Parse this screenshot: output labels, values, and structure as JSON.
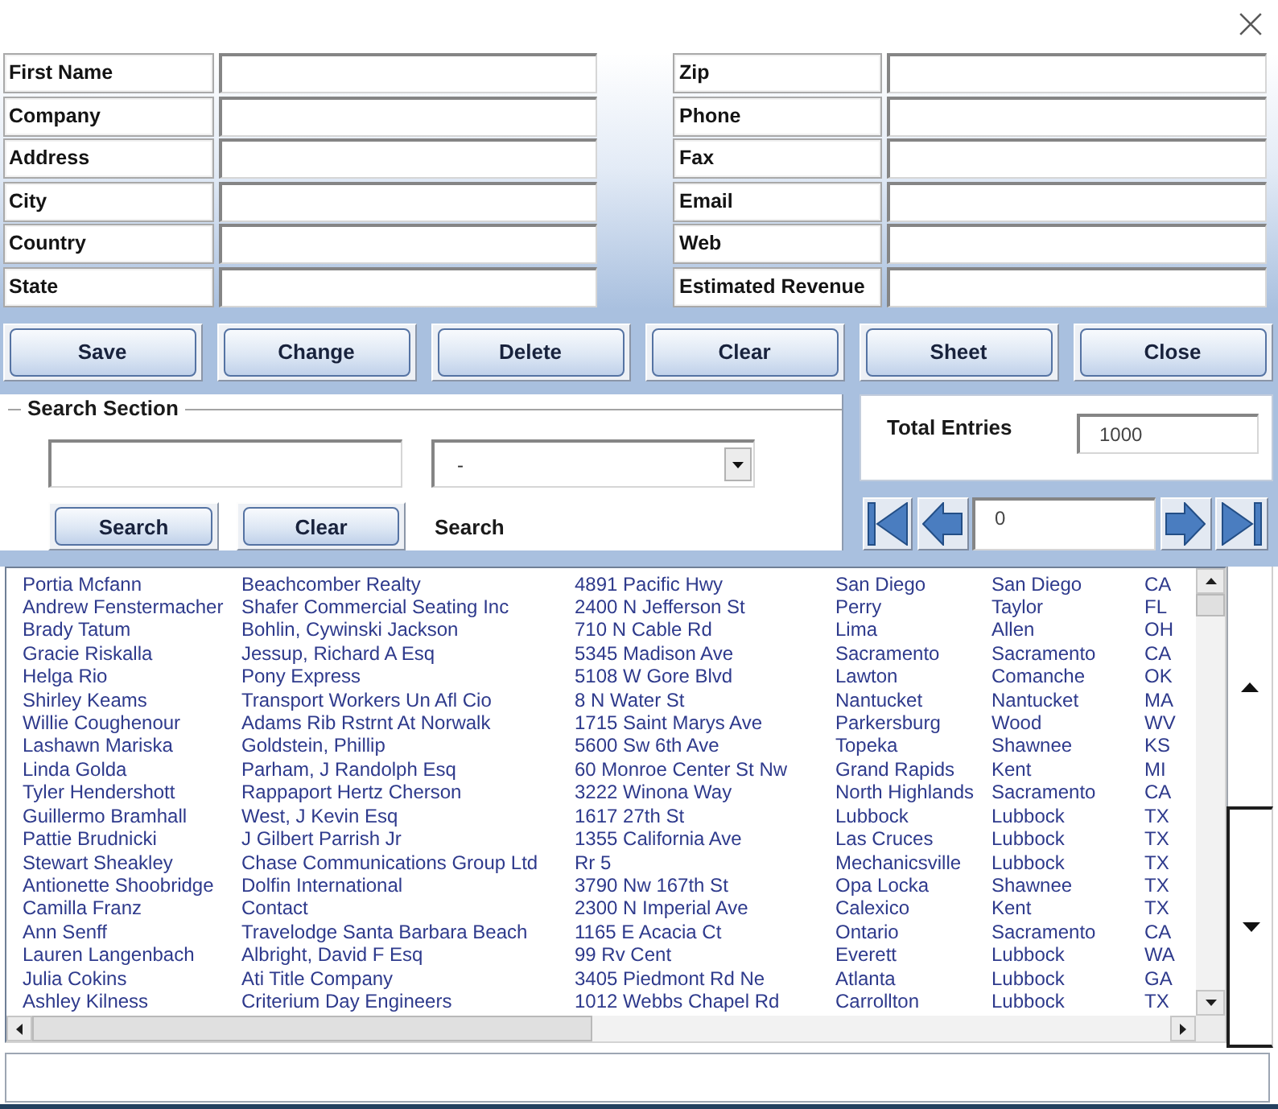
{
  "form": {
    "fields_left": [
      "First Name",
      "Company",
      "Address",
      "City",
      "Country",
      "State"
    ],
    "fields_right": [
      "Zip",
      "Phone",
      "Fax",
      "Email",
      "Web",
      "Estimated Revenue"
    ]
  },
  "buttons": [
    "Save",
    "Change",
    "Delete",
    "Clear",
    "Sheet",
    "Close"
  ],
  "search_section": {
    "title": "Search Section",
    "dropdown": {
      "value": "-"
    },
    "buttons": [
      "Search",
      "Clear"
    ],
    "label": "Search"
  },
  "total_entries": {
    "label": "Total Entries",
    "value": "1000"
  },
  "pager": {
    "value": "0"
  },
  "list": {
    "rows": [
      [
        "Portia Mcfann",
        "Beachcomber Realty",
        "4891 Pacific Hwy",
        "San Diego",
        "San Diego",
        "CA"
      ],
      [
        "Andrew Fenstermacher",
        "Shafer Commercial Seating Inc",
        "2400 N Jefferson St",
        "Perry",
        "Taylor",
        "FL"
      ],
      [
        "Brady Tatum",
        "Bohlin, Cywinski Jackson",
        "710 N Cable Rd",
        "Lima",
        "Allen",
        "OH"
      ],
      [
        "Gracie Riskalla",
        "Jessup, Richard A Esq",
        "5345 Madison Ave",
        "Sacramento",
        "Sacramento",
        "CA"
      ],
      [
        "Helga Rio",
        "Pony Express",
        "5108 W Gore Blvd",
        "Lawton",
        "Comanche",
        "OK"
      ],
      [
        "Shirley Keams",
        "Transport Workers Un Afl Cio",
        "8 N Water St",
        "Nantucket",
        "Nantucket",
        "MA"
      ],
      [
        "Willie Coughenour",
        "Adams Rib Rstrnt At Norwalk",
        "1715 Saint Marys Ave",
        "Parkersburg",
        "Wood",
        "WV"
      ],
      [
        "Lashawn Mariska",
        "Goldstein, Phillip",
        "5600 Sw 6th Ave",
        "Topeka",
        "Shawnee",
        "KS"
      ],
      [
        "Linda Golda",
        "Parham, J Randolph Esq",
        "60 Monroe Center St Nw",
        "Grand Rapids",
        "Kent",
        "MI"
      ],
      [
        "Tyler Hendershott",
        "Rappaport Hertz Cherson",
        "3222 Winona Way",
        "North Highlands",
        "Sacramento",
        "CA"
      ],
      [
        "Guillermo Bramhall",
        "West, J Kevin Esq",
        "1617 27th St",
        "Lubbock",
        "Lubbock",
        "TX"
      ],
      [
        "Pattie Brudnicki",
        "J Gilbert Parrish Jr",
        "1355 California Ave",
        "Las Cruces",
        "Lubbock",
        "TX"
      ],
      [
        "Stewart Sheakley",
        "Chase Communications Group Ltd",
        "Rr 5",
        "Mechanicsville",
        "Lubbock",
        "TX"
      ],
      [
        "Antionette Shoobridge",
        "Dolfin International",
        "3790 Nw 167th St",
        "Opa Locka",
        "Shawnee",
        "TX"
      ],
      [
        "Camilla Franz",
        "Contact",
        "2300 N Imperial Ave",
        "Calexico",
        "Kent",
        "TX"
      ],
      [
        "Ann Senff",
        "Travelodge Santa Barbara Beach",
        "1165 E Acacia Ct",
        "Ontario",
        "Sacramento",
        "CA"
      ],
      [
        "Lauren Langenbach",
        "Albright, David F Esq",
        "99 Rv Cent",
        "Everett",
        "Lubbock",
        "WA"
      ],
      [
        "Julia Cokins",
        "Ati Title Company",
        "3405 Piedmont Rd Ne",
        "Atlanta",
        "Lubbock",
        "GA"
      ],
      [
        "Ashley Kilness",
        "Criterium Day Engineers",
        "1012 Webbs Chapel Rd",
        "Carrollton",
        "Lubbock",
        "TX"
      ]
    ]
  }
}
